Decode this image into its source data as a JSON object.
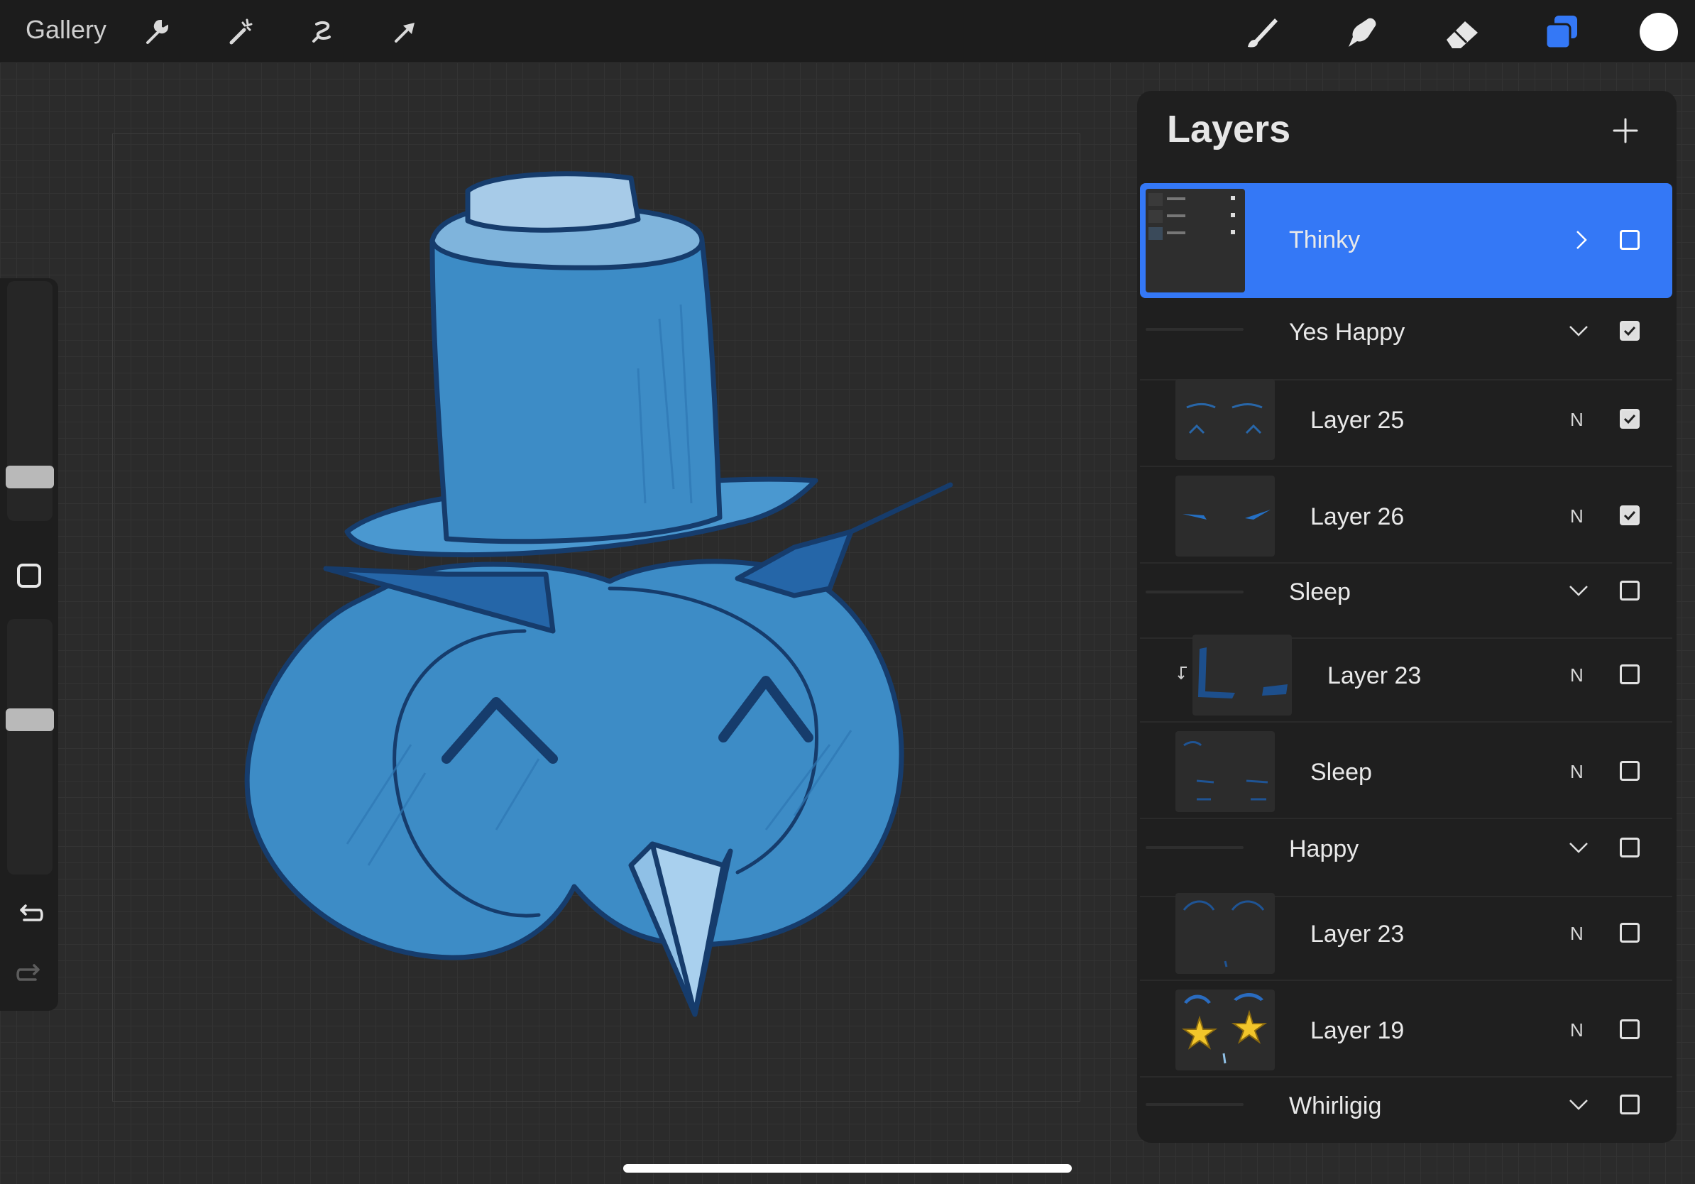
{
  "topbar": {
    "gallery_label": "Gallery",
    "left_tools": [
      "wrench-icon",
      "magic-wand-icon",
      "selection-icon",
      "transform-arrow-icon"
    ],
    "right_tools": [
      "brush-icon",
      "smudge-icon",
      "eraser-icon",
      "layers-icon"
    ],
    "current_color": "#ffffff"
  },
  "colors": {
    "accent": "#3478f6",
    "owl_body": "#3d8cc6",
    "owl_outline": "#163c6c",
    "owl_dark": "#1f5e9e",
    "owl_light": "#8fc0e6"
  },
  "sidebar": {
    "brush_size_level": 0.82,
    "opacity_level": 0.36,
    "icons": [
      "modify-square-icon",
      "undo-icon",
      "redo-icon"
    ]
  },
  "layers": {
    "title": "Layers",
    "add_icon": "plus-icon",
    "rows": [
      {
        "name": "Thinky",
        "kind": "group-selected",
        "visible": false
      },
      {
        "name": "Yes Happy",
        "kind": "group",
        "visible": true
      },
      {
        "name": "Layer 25",
        "kind": "layer",
        "blend": "N",
        "visible": true
      },
      {
        "name": "Layer 26",
        "kind": "layer",
        "blend": "N",
        "visible": true
      },
      {
        "name": "Sleep",
        "kind": "group",
        "visible": false
      },
      {
        "name": "Layer 23",
        "kind": "layer-clipped",
        "blend": "N",
        "visible": false
      },
      {
        "name": "Sleep",
        "kind": "layer",
        "blend": "N",
        "visible": false
      },
      {
        "name": "Happy",
        "kind": "group",
        "visible": false
      },
      {
        "name": "Layer 23",
        "kind": "layer",
        "blend": "N",
        "visible": false
      },
      {
        "name": "Layer 19",
        "kind": "layer",
        "blend": "N",
        "visible": false
      },
      {
        "name": "Whirligig",
        "kind": "group",
        "visible": false
      }
    ]
  }
}
